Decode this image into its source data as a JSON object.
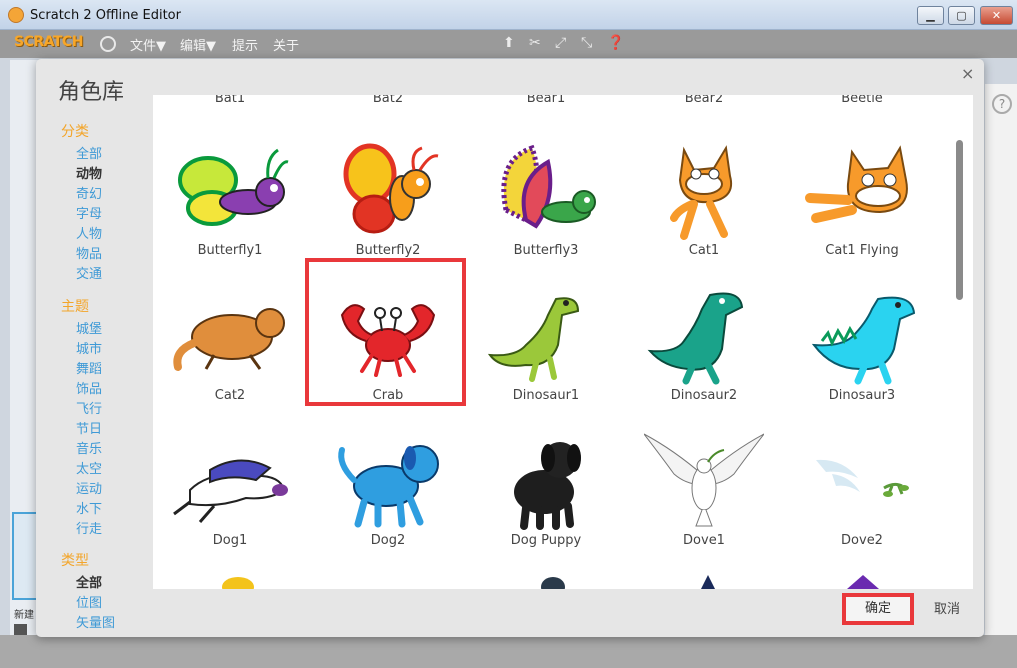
{
  "window": {
    "title": "Scratch 2 Offline Editor",
    "min_label": "▁",
    "max_label": "▢",
    "close_label": "✕"
  },
  "menubar": {
    "logo": "SCRATCH",
    "items": [
      "文件▼",
      "编辑▼",
      "提示",
      "关于"
    ]
  },
  "dialog": {
    "title": "角色库",
    "close_label": "×",
    "sections": [
      {
        "title": "分类",
        "items": [
          "全部",
          "动物",
          "奇幻",
          "字母",
          "人物",
          "物品",
          "交通"
        ],
        "active": "动物"
      },
      {
        "title": "主题",
        "items": [
          "城堡",
          "城市",
          "舞蹈",
          "饰品",
          "飞行",
          "节日",
          "音乐",
          "太空",
          "运动",
          "水下",
          "行走"
        ]
      },
      {
        "title": "类型",
        "items": [
          "全部",
          "位图",
          "矢量图"
        ],
        "active": "全部"
      }
    ],
    "partial_top_labels": [
      "Bat1",
      "Bat2",
      "Bear1",
      "Bear2",
      "Beetle"
    ],
    "sprites": [
      [
        "Butterfly1",
        "Butterfly2",
        "Butterfly3",
        "Cat1",
        "Cat1 Flying"
      ],
      [
        "Cat2",
        "Crab",
        "Dinosaur1",
        "Dinosaur2",
        "Dinosaur3"
      ],
      [
        "Dog1",
        "Dog2",
        "Dog Puppy",
        "Dove1",
        "Dove2"
      ]
    ],
    "selected": "Crab",
    "ok_label": "确定",
    "cancel_label": "取消"
  },
  "background": {
    "new_label": "新建",
    "help_label": "?"
  },
  "colors": {
    "accent_orange": "#f3a52a",
    "link_blue": "#3f9ad6",
    "selection_red": "#e9383b"
  }
}
